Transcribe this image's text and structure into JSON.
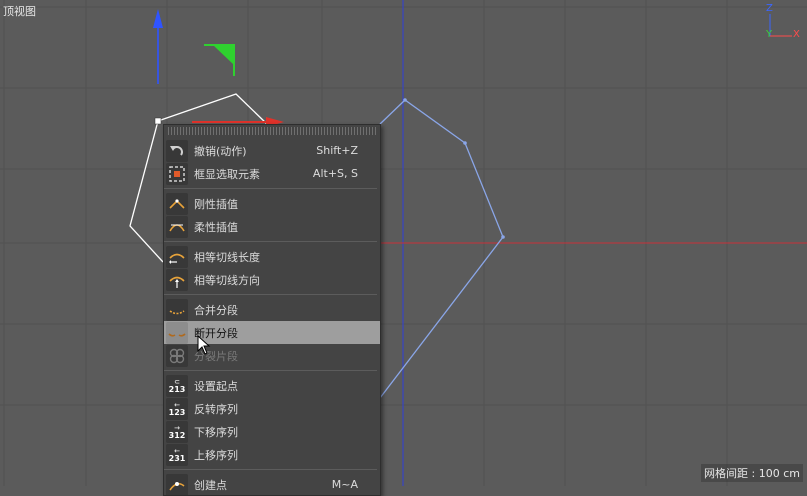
{
  "viewport": {
    "label": "顶视图",
    "grid_info": "网格间距 : 100 cm",
    "axis_labels": {
      "z": "Z",
      "y": "Y",
      "x": "X"
    },
    "colors": {
      "background": "#5b5b5b",
      "grid": "#525252",
      "axis_x": "#e0322a",
      "axis_y": "#2fd12f",
      "axis_z": "#2f54ff",
      "spline_selected": "#ffffff",
      "spline": "#8aa6e8"
    }
  },
  "menu": {
    "items": [
      {
        "label": "撤销(动作)",
        "shortcut": "Shift+Z",
        "icon": "undo-icon"
      },
      {
        "label": "框显选取元素",
        "shortcut": "Alt+S, S",
        "icon": "frame-selected-icon"
      },
      {
        "label": "刚性插值",
        "shortcut": "",
        "icon": "hard-interpolation-icon"
      },
      {
        "label": "柔性插值",
        "shortcut": "",
        "icon": "soft-interpolation-icon"
      },
      {
        "label": "相等切线长度",
        "shortcut": "",
        "icon": "equal-tangent-length-icon"
      },
      {
        "label": "相等切线方向",
        "shortcut": "",
        "icon": "equal-tangent-direction-icon"
      },
      {
        "label": "合并分段",
        "shortcut": "",
        "icon": "join-segment-icon"
      },
      {
        "label": "断开分段",
        "shortcut": "",
        "icon": "break-segment-icon"
      },
      {
        "label": "分裂片段",
        "shortcut": "",
        "icon": "explode-segments-icon"
      },
      {
        "label": "设置起点",
        "shortcut": "",
        "icon": "set-first-point-icon",
        "icon_text": "213"
      },
      {
        "label": "反转序列",
        "shortcut": "",
        "icon": "reverse-sequence-icon",
        "icon_text": "123"
      },
      {
        "label": "下移序列",
        "shortcut": "",
        "icon": "move-down-sequence-icon",
        "icon_text": "312"
      },
      {
        "label": "上移序列",
        "shortcut": "",
        "icon": "move-up-sequence-icon",
        "icon_text": "231"
      },
      {
        "label": "创建点",
        "shortcut": "M~A",
        "icon": "create-point-icon"
      }
    ],
    "highlighted_label": "断开分段",
    "disabled_label": "分裂片段"
  }
}
